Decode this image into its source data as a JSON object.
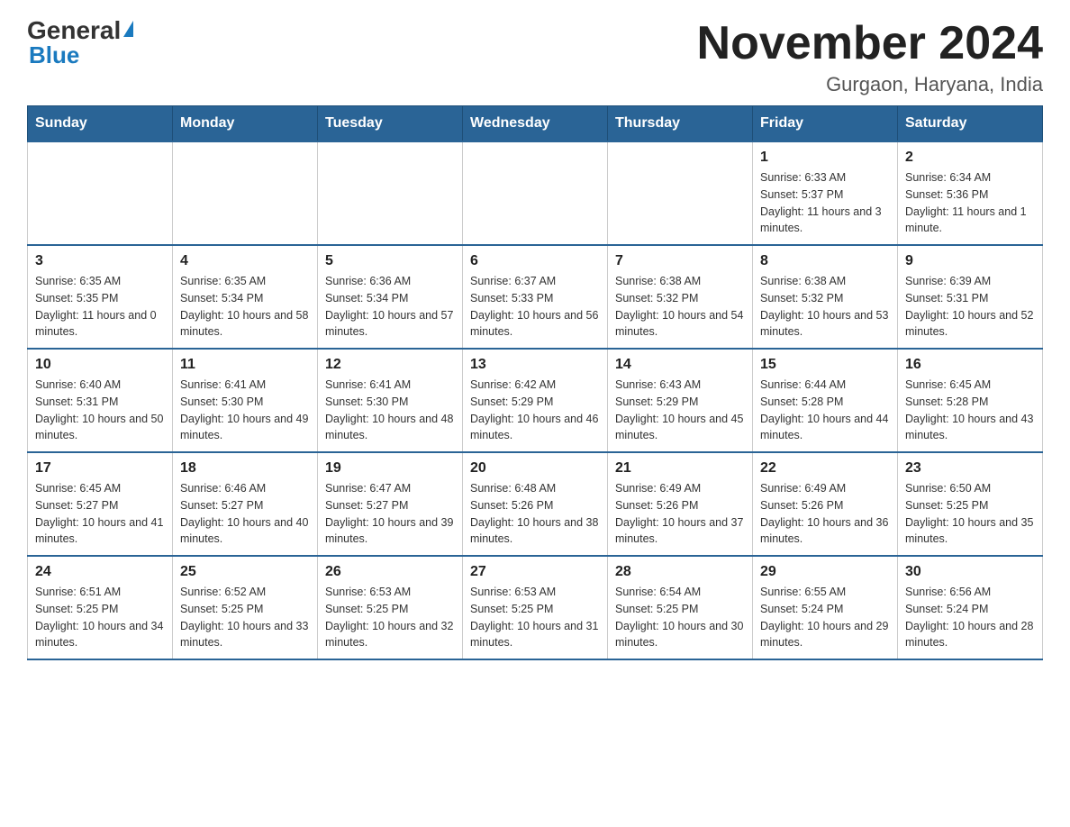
{
  "header": {
    "logo_general": "General",
    "logo_blue": "Blue",
    "month_title": "November 2024",
    "location": "Gurgaon, Haryana, India"
  },
  "weekdays": [
    "Sunday",
    "Monday",
    "Tuesday",
    "Wednesday",
    "Thursday",
    "Friday",
    "Saturday"
  ],
  "weeks": [
    [
      {
        "day": "",
        "info": ""
      },
      {
        "day": "",
        "info": ""
      },
      {
        "day": "",
        "info": ""
      },
      {
        "day": "",
        "info": ""
      },
      {
        "day": "",
        "info": ""
      },
      {
        "day": "1",
        "info": "Sunrise: 6:33 AM\nSunset: 5:37 PM\nDaylight: 11 hours and 3 minutes."
      },
      {
        "day": "2",
        "info": "Sunrise: 6:34 AM\nSunset: 5:36 PM\nDaylight: 11 hours and 1 minute."
      }
    ],
    [
      {
        "day": "3",
        "info": "Sunrise: 6:35 AM\nSunset: 5:35 PM\nDaylight: 11 hours and 0 minutes."
      },
      {
        "day": "4",
        "info": "Sunrise: 6:35 AM\nSunset: 5:34 PM\nDaylight: 10 hours and 58 minutes."
      },
      {
        "day": "5",
        "info": "Sunrise: 6:36 AM\nSunset: 5:34 PM\nDaylight: 10 hours and 57 minutes."
      },
      {
        "day": "6",
        "info": "Sunrise: 6:37 AM\nSunset: 5:33 PM\nDaylight: 10 hours and 56 minutes."
      },
      {
        "day": "7",
        "info": "Sunrise: 6:38 AM\nSunset: 5:32 PM\nDaylight: 10 hours and 54 minutes."
      },
      {
        "day": "8",
        "info": "Sunrise: 6:38 AM\nSunset: 5:32 PM\nDaylight: 10 hours and 53 minutes."
      },
      {
        "day": "9",
        "info": "Sunrise: 6:39 AM\nSunset: 5:31 PM\nDaylight: 10 hours and 52 minutes."
      }
    ],
    [
      {
        "day": "10",
        "info": "Sunrise: 6:40 AM\nSunset: 5:31 PM\nDaylight: 10 hours and 50 minutes."
      },
      {
        "day": "11",
        "info": "Sunrise: 6:41 AM\nSunset: 5:30 PM\nDaylight: 10 hours and 49 minutes."
      },
      {
        "day": "12",
        "info": "Sunrise: 6:41 AM\nSunset: 5:30 PM\nDaylight: 10 hours and 48 minutes."
      },
      {
        "day": "13",
        "info": "Sunrise: 6:42 AM\nSunset: 5:29 PM\nDaylight: 10 hours and 46 minutes."
      },
      {
        "day": "14",
        "info": "Sunrise: 6:43 AM\nSunset: 5:29 PM\nDaylight: 10 hours and 45 minutes."
      },
      {
        "day": "15",
        "info": "Sunrise: 6:44 AM\nSunset: 5:28 PM\nDaylight: 10 hours and 44 minutes."
      },
      {
        "day": "16",
        "info": "Sunrise: 6:45 AM\nSunset: 5:28 PM\nDaylight: 10 hours and 43 minutes."
      }
    ],
    [
      {
        "day": "17",
        "info": "Sunrise: 6:45 AM\nSunset: 5:27 PM\nDaylight: 10 hours and 41 minutes."
      },
      {
        "day": "18",
        "info": "Sunrise: 6:46 AM\nSunset: 5:27 PM\nDaylight: 10 hours and 40 minutes."
      },
      {
        "day": "19",
        "info": "Sunrise: 6:47 AM\nSunset: 5:27 PM\nDaylight: 10 hours and 39 minutes."
      },
      {
        "day": "20",
        "info": "Sunrise: 6:48 AM\nSunset: 5:26 PM\nDaylight: 10 hours and 38 minutes."
      },
      {
        "day": "21",
        "info": "Sunrise: 6:49 AM\nSunset: 5:26 PM\nDaylight: 10 hours and 37 minutes."
      },
      {
        "day": "22",
        "info": "Sunrise: 6:49 AM\nSunset: 5:26 PM\nDaylight: 10 hours and 36 minutes."
      },
      {
        "day": "23",
        "info": "Sunrise: 6:50 AM\nSunset: 5:25 PM\nDaylight: 10 hours and 35 minutes."
      }
    ],
    [
      {
        "day": "24",
        "info": "Sunrise: 6:51 AM\nSunset: 5:25 PM\nDaylight: 10 hours and 34 minutes."
      },
      {
        "day": "25",
        "info": "Sunrise: 6:52 AM\nSunset: 5:25 PM\nDaylight: 10 hours and 33 minutes."
      },
      {
        "day": "26",
        "info": "Sunrise: 6:53 AM\nSunset: 5:25 PM\nDaylight: 10 hours and 32 minutes."
      },
      {
        "day": "27",
        "info": "Sunrise: 6:53 AM\nSunset: 5:25 PM\nDaylight: 10 hours and 31 minutes."
      },
      {
        "day": "28",
        "info": "Sunrise: 6:54 AM\nSunset: 5:25 PM\nDaylight: 10 hours and 30 minutes."
      },
      {
        "day": "29",
        "info": "Sunrise: 6:55 AM\nSunset: 5:24 PM\nDaylight: 10 hours and 29 minutes."
      },
      {
        "day": "30",
        "info": "Sunrise: 6:56 AM\nSunset: 5:24 PM\nDaylight: 10 hours and 28 minutes."
      }
    ]
  ]
}
